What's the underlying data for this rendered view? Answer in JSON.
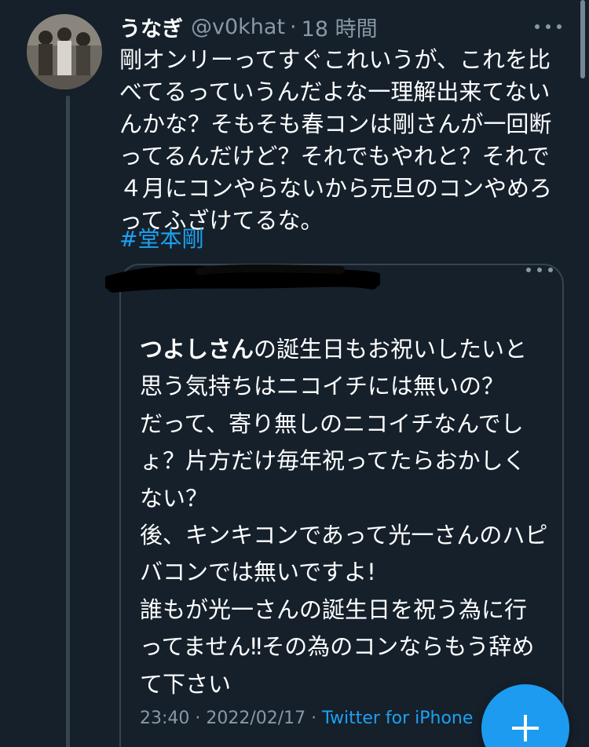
{
  "tweet": {
    "author_name": "うなぎ",
    "author_handle": "@v0khat",
    "separator": "·",
    "time_ago": "18 時間",
    "text": "剛オンリーってすぐこれいうが、これを比べてるっていうんだよな一理解出来てないんかな？そもそも春コンは剛さんが一回断ってるんだけど？それでもやれと？それで４月にコンやらないから元旦のコンやめろってふざけてるな。",
    "hashtag": "#堂本剛"
  },
  "quote": {
    "highlight": "つよしさん",
    "body": "の誕生日もお祝いしたいと思う気持ちはニコイチには無いの？\nだって、寄り無しのニコイチなんでしょ？片方だけ毎年祝ってたらおかしくない？\n後、キンキコンであって光一さんのハピバコンでは無いですよ!\n誰もが光一さんの誕生日を祝う為に行ってません‼︎その為のコンならもう辞めて下さい",
    "timestamp": "23:40 · 2022/02/17 · ",
    "source": "Twitter for iPhone"
  },
  "icons": {
    "more": "more-horizontal-icon",
    "compose": "plus-icon",
    "avatar": "avatar-photo"
  },
  "colors": {
    "background": "#15202b",
    "accent": "#1da1f2",
    "secondary_text": "#8899a6",
    "border": "#38444d"
  }
}
